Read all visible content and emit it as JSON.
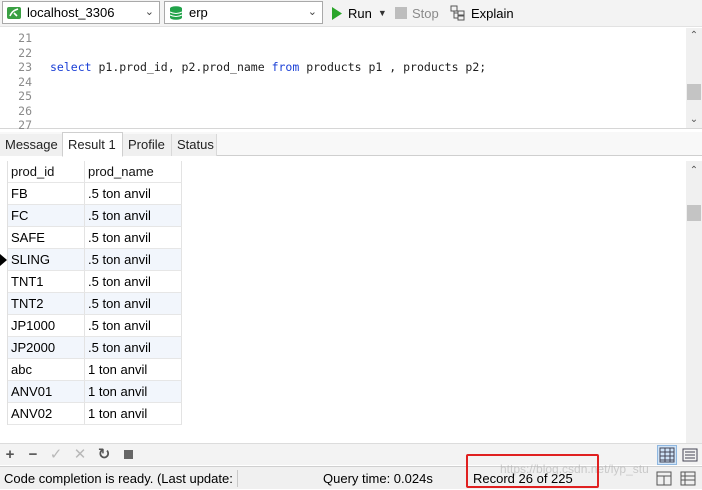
{
  "toolbar": {
    "connection": "localhost_3306",
    "database": "erp",
    "run_label": "Run",
    "stop_label": "Stop",
    "explain_label": "Explain"
  },
  "editor": {
    "lines": [
      {
        "num": "21",
        "text": ""
      },
      {
        "num": "22",
        "text": ""
      },
      {
        "num": "23",
        "text": "select p1.prod_id, p2.prod_name from products p1 , products p2;"
      },
      {
        "num": "24",
        "text": ""
      },
      {
        "num": "25",
        "text": ""
      },
      {
        "num": "26",
        "text": ""
      },
      {
        "num": "27",
        "text": ""
      }
    ],
    "query_parts": {
      "kw_select": "select",
      "cols": " p1.prod_id, p2.prod_name ",
      "kw_from": "from",
      "rest": " products p1 , products p2;"
    }
  },
  "tabs": [
    "Message",
    "Result 1",
    "Profile",
    "Status"
  ],
  "active_tab": "Result 1",
  "grid": {
    "columns": [
      "prod_id",
      "prod_name"
    ],
    "rows": [
      [
        "FB",
        ".5 ton anvil"
      ],
      [
        "FC",
        ".5 ton anvil"
      ],
      [
        "SAFE",
        ".5 ton anvil"
      ],
      [
        "SLING",
        ".5 ton anvil"
      ],
      [
        "TNT1",
        ".5 ton anvil"
      ],
      [
        "TNT2",
        ".5 ton anvil"
      ],
      [
        "JP1000",
        ".5 ton anvil"
      ],
      [
        "JP2000",
        ".5 ton anvil"
      ],
      [
        "abc",
        "1 ton anvil"
      ],
      [
        "ANV01",
        "1 ton anvil"
      ],
      [
        "ANV02",
        "1 ton anvil"
      ]
    ],
    "current_row_index": 3
  },
  "bottom_toolbar": {
    "icons": [
      "add-icon",
      "delete-icon",
      "apply-icon",
      "discard-icon",
      "refresh-icon",
      "stop-icon",
      "grid-view-icon",
      "form-view-icon"
    ]
  },
  "status": {
    "message": "Code completion is ready. (Last update:",
    "query_time": "Query time: 0.024s",
    "record": "Record 26 of 225",
    "watermark": "https://blog.csdn.net/lyp_stu"
  },
  "colors": {
    "keyword": "#1a3fd6",
    "highlight_box": "#e02020",
    "run_green": "#2aa52a",
    "db_green": "#22a34a"
  }
}
